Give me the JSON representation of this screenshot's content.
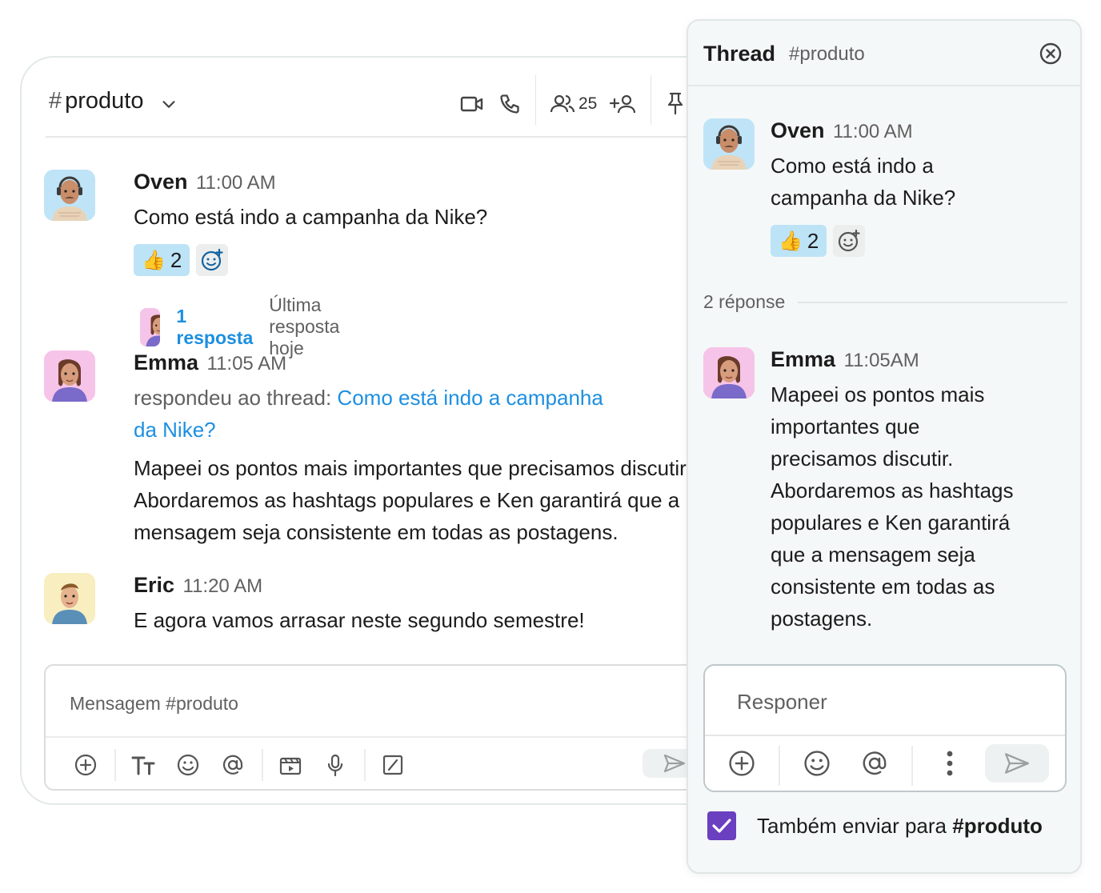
{
  "channel": {
    "hash": "#",
    "name": "produto",
    "member_count": "25",
    "icons": [
      "video-icon",
      "phone-icon",
      "members-icon",
      "add-member-icon",
      "pin-icon"
    ]
  },
  "messages": [
    {
      "author": "Oven",
      "time": "11:00 AM",
      "text": "Como está indo a campanha da Nike?",
      "reaction_emoji": "👍",
      "reaction_count": "2",
      "reply_count": "1 resposta",
      "reply_last": "Última resposta hoje"
    },
    {
      "author": "Emma",
      "time": "11:05 AM",
      "replied_prefix": "respondeu ao thread: ",
      "replied_link_1": "Como está indo a campanha",
      "replied_link_2": "da Nike?",
      "text_1": "Mapeei os pontos mais importantes que precisamos discutir.",
      "text_2": "Abordaremos as hashtags populares e Ken garantirá que a",
      "text_3": "mensagem seja consistente em todas as postagens."
    },
    {
      "author": "Eric",
      "time": "11:20 AM",
      "text": "E agora vamos arrasar neste segundo semestre!"
    }
  ],
  "composer": {
    "placeholder": "Mensagem #produto"
  },
  "thread": {
    "title": "Thread",
    "channel": "#produto",
    "parent": {
      "author": "Oven",
      "time": "11:00 AM",
      "text_1": "Como está indo a",
      "text_2": "campanha da Nike?",
      "reaction_emoji": "👍",
      "reaction_count": "2"
    },
    "separator": "2 réponse",
    "reply": {
      "author": "Emma",
      "time": "11:05AM",
      "lines": [
        "Mapeei os pontos mais",
        "importantes que",
        "precisamos discutir.",
        "Abordaremos as hashtags",
        "populares e Ken garantirá",
        "que a mensagem seja",
        "consistente em todas as",
        "postagens."
      ]
    },
    "composer_placeholder": "Responer",
    "also_send_prefix": "Também enviar para ",
    "also_send_channel": "#produto",
    "also_send_checked": true,
    "accent": "#6a3fc0",
    "link_color": "#1d8fe0",
    "reaction_bg": "#bde3f7"
  }
}
